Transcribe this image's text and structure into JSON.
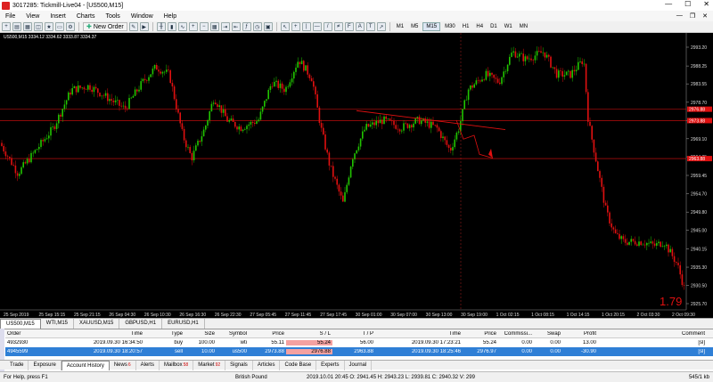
{
  "window": {
    "title": "3017285: Tickmill-Live04 - [US500,M15]"
  },
  "menu": [
    "File",
    "View",
    "Insert",
    "Charts",
    "Tools",
    "Window",
    "Help"
  ],
  "toolbar": {
    "new_order": "New Order",
    "timeframes": [
      "M1",
      "M5",
      "M15",
      "M30",
      "H1",
      "H4",
      "D1",
      "W1",
      "MN"
    ],
    "active_timeframe": "M15"
  },
  "chart": {
    "symbol_line": "US500,M15  3334.12 3334.62 3333.87 3334.37",
    "big_label": "1.79",
    "price_axis": [
      "2993.20",
      "2988.25",
      "2983.55",
      "2978.70",
      "2973.80",
      "2969.10",
      "2964.35",
      "2959.45",
      "2954.70",
      "2949.80",
      "2945.00",
      "2940.15",
      "2935.30",
      "2930.50",
      "2925.70"
    ],
    "price_tags": [
      "2976.88",
      "2973.88",
      "2963.88"
    ],
    "time_axis": [
      "25 Sep 2019",
      "25 Sep 15:15",
      "25 Sep 21:15",
      "26 Sep 04:30",
      "26 Sep 10:30",
      "26 Sep 16:30",
      "26 Sep 22:30",
      "27 Sep 05:45",
      "27 Sep 11:45",
      "27 Sep 17:45",
      "30 Sep 01:00",
      "30 Sep 07:00",
      "30 Sep 13:00",
      "30 Sep 19:00",
      "1 Oct 02:15",
      "1 Oct 08:15",
      "1 Oct 14:15",
      "1 Oct 20:15",
      "2 Oct 03:30",
      "2 Oct 09:30"
    ],
    "colors": {
      "bull": "#21c400",
      "bear": "#e01010",
      "line": "#e01010",
      "bg": "#000000"
    }
  },
  "chart_tabs": [
    "US500,M15",
    "WTI,M15",
    "XAUUSD,M15",
    "GBPUSD,H1",
    "EURUSD,H1"
  ],
  "orders": {
    "headers": [
      "Order",
      "Time",
      "Type",
      "Size",
      "Symbol",
      "Price",
      "S / L",
      "T / P",
      "Time",
      "Price",
      "Commissi...",
      "Swap",
      "Profit",
      "",
      "Comment"
    ],
    "rows": [
      [
        "4932930",
        "2019.09.30 16:34:50",
        "buy",
        "100.00",
        "wti",
        "55.11",
        "55.24",
        "56.00",
        "2019.09.30 17:23:21",
        "55.24",
        "0.00",
        "0.00",
        "13.00",
        "",
        "[sl]"
      ],
      [
        "4945599",
        "2019.09.30 18:20:57",
        "sell",
        "10.00",
        "us500",
        "2973.88",
        "2976.88",
        "2963.88",
        "2019.09.30 18:25:46",
        "2976.97",
        "0.00",
        "0.00",
        "-30.90",
        "",
        "[sl]"
      ]
    ]
  },
  "terminal_tabs": [
    {
      "label": "Trade"
    },
    {
      "label": "Exposure"
    },
    {
      "label": "Account History"
    },
    {
      "label": "News",
      "count": "6"
    },
    {
      "label": "Alerts"
    },
    {
      "label": "Mailbox",
      "count": "58"
    },
    {
      "label": "Market",
      "count": "92"
    },
    {
      "label": "Signals"
    },
    {
      "label": "Articles"
    },
    {
      "label": "Code Base"
    },
    {
      "label": "Experts"
    },
    {
      "label": "Journal"
    }
  ],
  "status": {
    "help": "For Help, press F1",
    "profile": "British Pound",
    "ohlc": "2019.10.01 20:45   O: 2941.45   H: 2943.23   L: 2939.81   C: 2940.32   V: 299",
    "traffic": "545/1 kb"
  }
}
